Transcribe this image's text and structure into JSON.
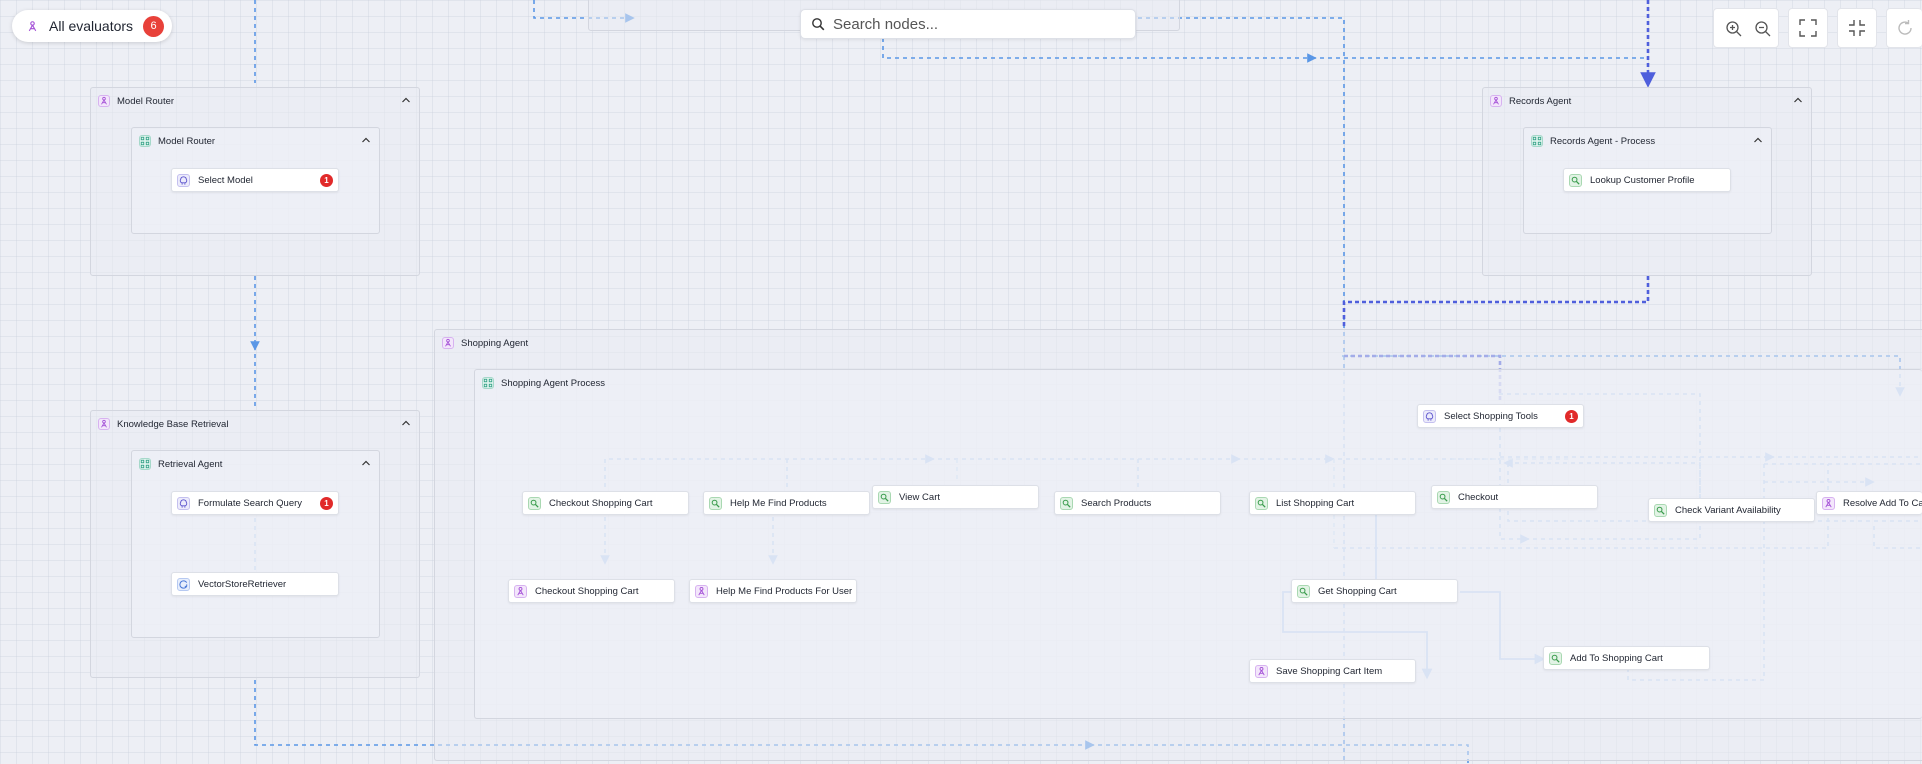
{
  "toolbar": {
    "evaluator_filter_label": "All evaluators",
    "evaluator_count": "6",
    "search_placeholder": "Search nodes...",
    "zoom_in_icon": "zoom-in-icon",
    "zoom_out_icon": "zoom-out-icon",
    "fit_view_icon": "fit-view-icon",
    "collapse_icon": "collapse-icon",
    "refresh_icon": "refresh-icon"
  },
  "colors": {
    "edge": "#5a97e6",
    "edge_active": "#4f5fdc",
    "edge_light": "#8fc6ee",
    "badge": "#e12a2a",
    "canvas": "#edeff5"
  },
  "groups": {
    "model_router": {
      "label": "Model Router",
      "inner_label": "Model Router"
    },
    "knowledge_base": {
      "label": "Knowledge Base Retrieval",
      "inner_label": "Retrieval Agent"
    },
    "records_agent": {
      "label": "Records Agent",
      "inner_label": "Records Agent - Process"
    },
    "shopping_agent": {
      "label": "Shopping Agent",
      "inner_label": "Shopping Agent Process"
    }
  },
  "nodes": {
    "select_model": {
      "label": "Select Model",
      "badge": "1"
    },
    "formulate_search_query": {
      "label": "Formulate Search Query",
      "badge": "1"
    },
    "vector_store_retriever": {
      "label": "VectorStoreRetriever"
    },
    "lookup_customer_profile": {
      "label": "Lookup Customer Profile"
    },
    "select_shopping_tools": {
      "label": "Select Shopping Tools",
      "badge": "1"
    },
    "checkout_shopping_cart_tool": {
      "label": "Checkout Shopping Cart"
    },
    "help_me_find_products_tool": {
      "label": "Help Me Find Products"
    },
    "view_cart": {
      "label": "View Cart"
    },
    "search_products": {
      "label": "Search Products"
    },
    "list_shopping_cart": {
      "label": "List Shopping Cart"
    },
    "checkout": {
      "label": "Checkout"
    },
    "check_variant_availability": {
      "label": "Check Variant Availability"
    },
    "resolve_add_to_cart": {
      "label": "Resolve Add To Cart"
    },
    "checkout_shopping_cart_agent": {
      "label": "Checkout Shopping Cart"
    },
    "help_me_find_products_for_user": {
      "label": "Help Me Find Products For User"
    },
    "get_shopping_cart": {
      "label": "Get Shopping Cart"
    },
    "save_shopping_cart_item": {
      "label": "Save Shopping Cart Item"
    },
    "add_to_shopping_cart": {
      "label": "Add To Shopping Cart"
    }
  }
}
